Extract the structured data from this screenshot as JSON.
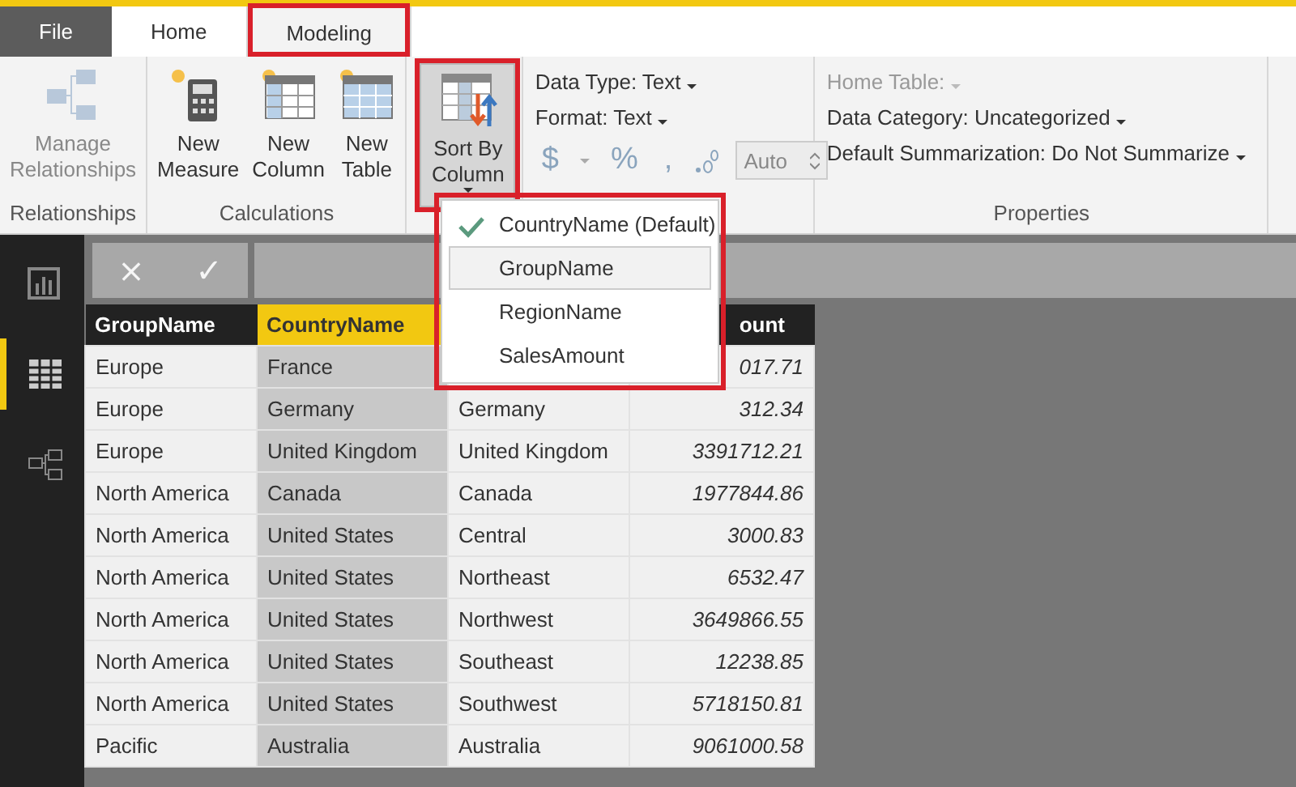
{
  "tabs": [
    {
      "label": "File",
      "kind": "file",
      "selected": false,
      "outlined": false
    },
    {
      "label": "Home",
      "kind": "tab",
      "selected": false,
      "outlined": false
    },
    {
      "label": "Modeling",
      "kind": "tab",
      "selected": true,
      "outlined": true
    }
  ],
  "ribbon": {
    "groups": [
      {
        "label": "Relationships",
        "kind": "large",
        "buttons": [
          {
            "label": "Manage Relationships",
            "disabled": true
          }
        ]
      },
      {
        "label": "Calculations",
        "kind": "large",
        "buttons": [
          {
            "label": "New Measure",
            "disabled": false
          },
          {
            "label": "New Column",
            "disabled": false
          },
          {
            "label": "New Table",
            "disabled": false
          }
        ]
      },
      {
        "kind": "sort",
        "buttons": [
          {
            "label": "Sort By Column",
            "pressed": true,
            "outlined": true
          }
        ]
      },
      {
        "kind": "format",
        "fields": [
          {
            "label": "Data Type: Text",
            "disabled": false
          },
          {
            "label": "Format: Text",
            "disabled": false
          }
        ],
        "symbols": [
          {
            "text": "$",
            "kind": "currency"
          },
          {
            "text": "%",
            "kind": "percent"
          },
          {
            "text": ",",
            "kind": "comma"
          }
        ],
        "decimals": {
          "value": "Auto"
        }
      },
      {
        "label": "Properties",
        "kind": "props",
        "fields": [
          {
            "label": "Home Table:",
            "disabled": true
          },
          {
            "label": "Data Category: Uncategorized",
            "disabled": false
          },
          {
            "label": "Default Summarization: Do Not Summarize",
            "disabled": false
          }
        ]
      }
    ]
  },
  "nav": [
    {
      "selected": false
    },
    {
      "selected": true
    },
    {
      "selected": false
    }
  ],
  "formula_bar": {
    "cancel": "×",
    "commit": "✓"
  },
  "table": {
    "columns": [
      {
        "label": "GroupName",
        "selected": false
      },
      {
        "label": "CountryName",
        "selected": true
      },
      {},
      {
        "label": "ount",
        "selected": false
      }
    ],
    "rows": [
      [
        "Europe",
        "France",
        null,
        "017.71"
      ],
      [
        "Europe",
        "Germany",
        "Germany",
        "312.34"
      ],
      [
        "Europe",
        "United Kingdom",
        "United Kingdom",
        "3391712.21"
      ],
      [
        "North America",
        "Canada",
        "Canada",
        "1977844.86"
      ],
      [
        "North America",
        "United States",
        "Central",
        "3000.83"
      ],
      [
        "North America",
        "United States",
        "Northeast",
        "6532.47"
      ],
      [
        "North America",
        "United States",
        "Northwest",
        "3649866.55"
      ],
      [
        "North America",
        "United States",
        "Southeast",
        "12238.85"
      ],
      [
        "North America",
        "United States",
        "Southwest",
        "5718150.81"
      ],
      [
        "Pacific",
        "Australia",
        "Australia",
        "9061000.58"
      ]
    ]
  },
  "sort_menu": {
    "outlined": true,
    "items": [
      {
        "label": "CountryName (Default)",
        "checked": true,
        "hovered": false
      },
      {
        "label": "GroupName",
        "checked": false,
        "hovered": true
      },
      {
        "label": "RegionName",
        "checked": false,
        "hovered": false
      },
      {
        "label": "SalesAmount",
        "checked": false,
        "hovered": false
      }
    ]
  }
}
